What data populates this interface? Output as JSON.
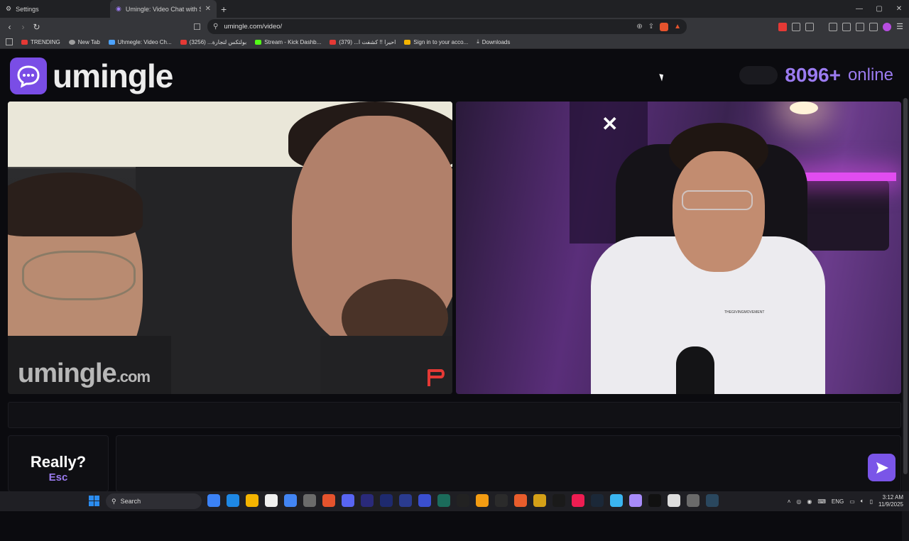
{
  "browser": {
    "tabs": [
      {
        "label": "Settings"
      },
      {
        "label": "Umingle: Video Chat with Str"
      }
    ],
    "new_tab": "+",
    "url": "umingle.com/video/",
    "bookmarks": [
      {
        "label": "TRENDING",
        "color": "#e53935"
      },
      {
        "label": "New Tab",
        "color": "#9e9e9e"
      },
      {
        "label": "Uhmegle: Video Ch...",
        "color": "#4da3ff"
      },
      {
        "label": "بولتكس لتجارة... (3256)",
        "color": "#e53935"
      },
      {
        "label": "Stream - Kick Dashb...",
        "color": "#53fc18"
      },
      {
        "label": "احيرا !! كشفت ا... (379)",
        "color": "#e53935"
      },
      {
        "label": "Sign in to your acco...",
        "color": "#f4b400"
      },
      {
        "label": "Downloads",
        "color": "#9e9e9e"
      }
    ]
  },
  "header": {
    "logo_text": "umingle",
    "online_count": "8096+",
    "online_label": "online",
    "accent": "#9b7bf0"
  },
  "videos": {
    "left_watermark_main": "umingle",
    "left_watermark_domain": ".com",
    "shirt_text": "THEGIVINGMOVEMENT"
  },
  "controls": {
    "esc_title": "Really?",
    "esc_key": "Esc",
    "send_color": "#7a55e8"
  },
  "taskbar": {
    "search_label": "Search",
    "language": "ENG",
    "time": "3:12 AM",
    "date": "11/9/2025",
    "apps": [
      "#3b82f6",
      "#1e88e5",
      "#f4b400",
      "#f0f0f0",
      "#4285f4",
      "#6b6b6b",
      "#e5532d",
      "#5865f2",
      "#2a2a7a",
      "#1e2a6e",
      "#2a3b8f",
      "#3a4fd0",
      "#1b6b5b",
      "#222",
      "#f39c12",
      "#2b2b2b",
      "#e85d2c",
      "#d4a017",
      "#1a1a1a",
      "#ee1d52",
      "#1b2838",
      "#3ab5f0",
      "#a78bfa",
      "#111",
      "#ddd",
      "#6a6a6a",
      "#2a475e"
    ]
  }
}
